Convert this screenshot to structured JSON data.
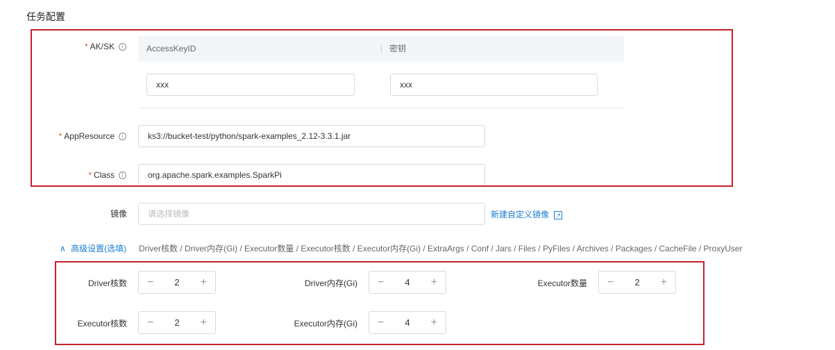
{
  "section_title": "任务配置",
  "aksk": {
    "label": "AK/SK",
    "col1": "AccessKeyID",
    "col2": "密钥",
    "access_key_value": "xxx",
    "secret_value": "xxx"
  },
  "app_resource": {
    "label": "AppResource",
    "value": "ks3://bucket-test/python/spark-examples_2.12-3.3.1.jar"
  },
  "class_field": {
    "label": "Class",
    "value": "org.apache.spark.examples.SparkPi"
  },
  "image": {
    "label": "镜像",
    "placeholder": "请选择镜像",
    "new_link": "新建自定义镜像"
  },
  "advanced": {
    "toggle": "高级设置(选填)",
    "desc": "Driver核数 / Driver内存(Gi) / Executor数量 / Executor核数 / Executor内存(Gi) / ExtraArgs / Conf / Jars / Files / PyFiles / Archives / Packages / CacheFile / ProxyUser"
  },
  "steppers": [
    {
      "label": "Driver核数",
      "value": "2"
    },
    {
      "label": "Driver内存(Gi)",
      "value": "4"
    },
    {
      "label": "Executor数量",
      "value": "2"
    },
    {
      "label": "Executor核数",
      "value": "2"
    },
    {
      "label": "Executor内存(Gi)",
      "value": "4"
    }
  ],
  "symbols": {
    "required": "*",
    "info": "i",
    "minus": "−",
    "plus": "+",
    "chevron": "∧",
    "external": "↗"
  }
}
